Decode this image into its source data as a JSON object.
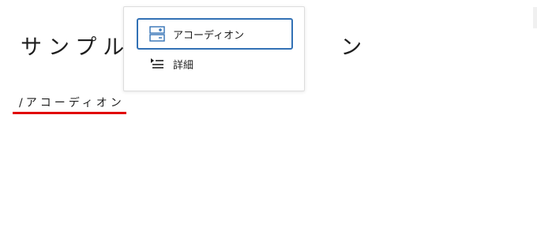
{
  "editor": {
    "title_left": "サンプル",
    "title_right": "ン",
    "slash_command": "/アコーディオン"
  },
  "block_menu": {
    "items": [
      {
        "label": "アコーディオン",
        "icon": "accordion-icon",
        "selected": true
      },
      {
        "label": "詳細",
        "icon": "details-list-icon",
        "selected": false
      }
    ]
  },
  "colors": {
    "selection_border": "#3271b5",
    "underline": "#e10000",
    "text": "#1e1e1e"
  }
}
